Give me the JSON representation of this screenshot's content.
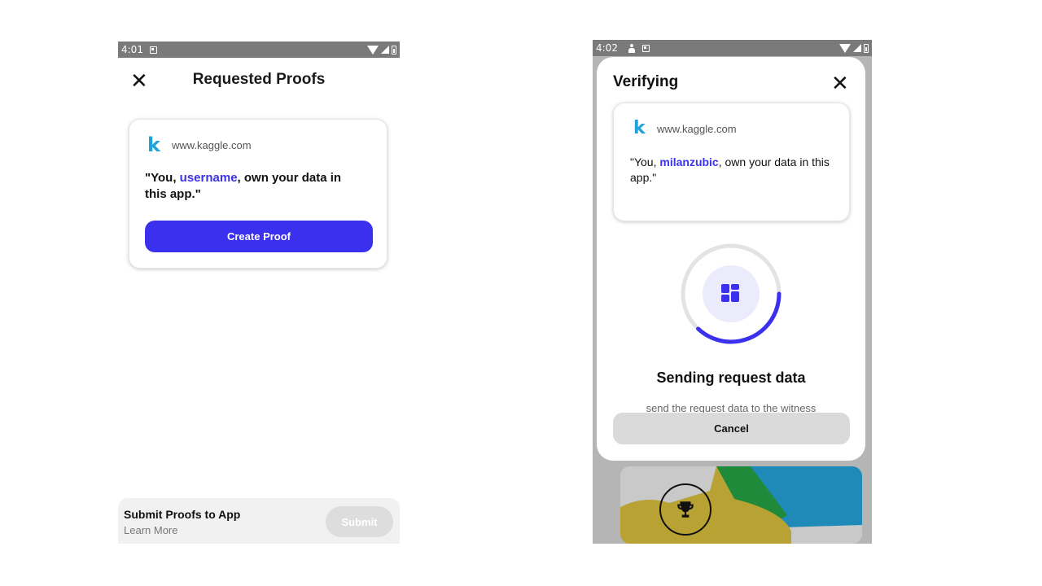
{
  "left_screen": {
    "status_bar": {
      "time": "4:01"
    },
    "close_icon": "close-icon",
    "title": "Requested Proofs",
    "card": {
      "logo_letter": "k",
      "domain": "www.kaggle.com",
      "claim_prefix": "\"You, ",
      "claim_highlight": "username",
      "claim_suffix": ", own your data in this app.\"",
      "button_label": "Create Proof"
    },
    "bottom_bar": {
      "title": "Submit Proofs to App",
      "link": "Learn More",
      "submit_label": "Submit"
    }
  },
  "right_screen": {
    "status_bar": {
      "time": "4:02"
    },
    "modal": {
      "title": "Verifying",
      "close_icon": "close-icon",
      "card": {
        "logo_letter": "k",
        "domain": "www.kaggle.com",
        "claim_prefix": "\"You, ",
        "claim_highlight": "milanzubic",
        "claim_suffix": ", own your data in this app.\""
      },
      "progress_fraction": 0.37,
      "center_icon": "grid-icon",
      "status_title": "Sending request data",
      "status_subtitle": "send the request data to the witness",
      "cancel_label": "Cancel"
    },
    "background_icon": "trophy-icon"
  },
  "colors": {
    "accent": "#3a30ee",
    "highlight_text": "#3b33e6",
    "kaggle_blue": "#20a3da",
    "status_bar": "#7a7a7a"
  }
}
